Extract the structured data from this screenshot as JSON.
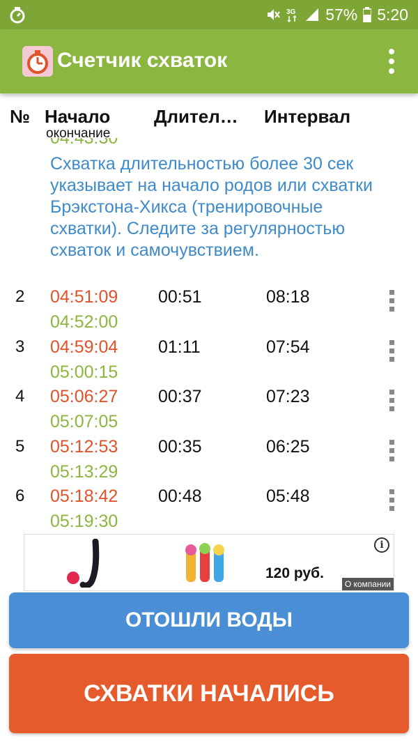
{
  "status_bar": {
    "battery": "57%",
    "time": "5:20",
    "network": "3G",
    "icons": [
      "app-notification-icon",
      "mute-icon",
      "network-3g-icon",
      "signal-icon",
      "battery-icon"
    ]
  },
  "app_bar": {
    "title": "Счетчик схваток",
    "logo_icon": "stopwatch-logo-icon",
    "menu_icon": "overflow-menu-icon"
  },
  "columns": {
    "num": "№",
    "start": "Начало",
    "start_sub": "окончание",
    "duration": "Длител…",
    "interval": "Интервал"
  },
  "info_text": "Схватка длительностью более 30 сек указывает на начало родов или схватки Брэкстона-Хикса (тренировочные схватки). Следите за регулярностью схваток и самочувствием.",
  "rows": [
    {
      "num": "2",
      "start": "04:51:09",
      "end": "04:52:00",
      "duration": "00:51",
      "interval": "08:18"
    },
    {
      "num": "3",
      "start": "04:59:04",
      "end": "05:00:15",
      "duration": "01:11",
      "interval": "07:54"
    },
    {
      "num": "4",
      "start": "05:06:27",
      "end": "05:07:05",
      "duration": "00:37",
      "interval": "07:23"
    },
    {
      "num": "5",
      "start": "05:12:53",
      "end": "05:13:29",
      "duration": "00:35",
      "interval": "06:25"
    },
    {
      "num": "6",
      "start": "05:18:42",
      "end": "05:19:30",
      "duration": "00:48",
      "interval": "05:48"
    }
  ],
  "ad": {
    "price": "120 руб.",
    "company_label": "О компании",
    "info_label": "i"
  },
  "buttons": {
    "water": "ОТОШЛИ ВОДЫ",
    "contractions": "СХВАТКИ НАЧАЛИСЬ"
  },
  "colors": {
    "status_bar": "#7da637",
    "app_bar": "#8bb63f",
    "start_time": "#e0522a",
    "end_time": "#8bb63f",
    "info_text": "#3f8ac9",
    "water_button": "#4a8fd6",
    "start_button": "#e55b2c"
  }
}
